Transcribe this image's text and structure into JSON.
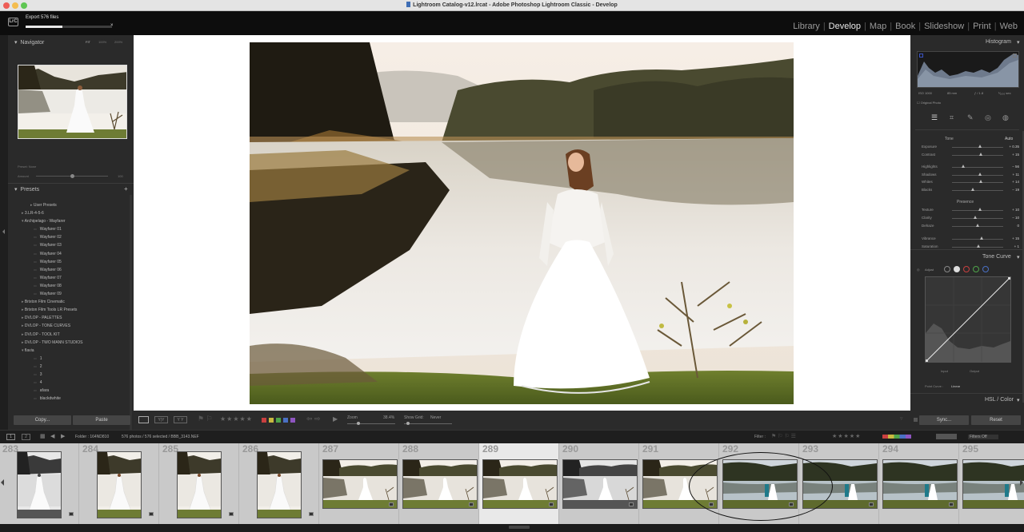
{
  "window": {
    "title": "Lightroom Catalog-v12.lrcat - Adobe Photoshop Lightroom Classic - Develop"
  },
  "identity": {
    "logo": "LrC",
    "export_label": "Export 576 files",
    "export_progress": 0.43,
    "cancel_glyph": "×"
  },
  "modules": [
    {
      "label": "Library"
    },
    {
      "label": "Develop"
    },
    {
      "label": "Map"
    },
    {
      "label": "Book"
    },
    {
      "label": "Slideshow"
    },
    {
      "label": "Print"
    },
    {
      "label": "Web"
    }
  ],
  "navigator": {
    "title": "Navigator",
    "zoom_fit": "FIT",
    "zoom_100": "100%",
    "zoom_200": "200%"
  },
  "preset_amount": {
    "label": "Preset: None",
    "amount_label": "Amount",
    "amount_value": "100"
  },
  "presets": {
    "title": "Presets",
    "add_glyph": "+",
    "items": [
      {
        "label": "User Presets",
        "level": 1
      },
      {
        "label": "3.LR-4-5-6",
        "level": 0
      },
      {
        "label": "Archipelago - Wayfarer",
        "level": 0
      },
      {
        "label": "Wayfarer 01",
        "level": 2
      },
      {
        "label": "Wayfarer 02",
        "level": 2
      },
      {
        "label": "Wayfarer 03",
        "level": 2
      },
      {
        "label": "Wayfarer 04",
        "level": 2
      },
      {
        "label": "Wayfarer 05",
        "level": 2
      },
      {
        "label": "Wayfarer 06",
        "level": 2
      },
      {
        "label": "Wayfarer 07",
        "level": 2
      },
      {
        "label": "Wayfarer 08",
        "level": 2
      },
      {
        "label": "Wayfarer 09",
        "level": 2
      },
      {
        "label": "Brixton Film Cinematic",
        "level": 0
      },
      {
        "label": "Brixton Film Tools LR Presets",
        "level": 0
      },
      {
        "label": "DVLOP - PALETTES",
        "level": 0
      },
      {
        "label": "DVLOP - TONE CURVES",
        "level": 0
      },
      {
        "label": "DVLOP - TOOL KIT",
        "level": 0
      },
      {
        "label": "DVLOP - TWO MANN STUDIOS",
        "level": 0
      },
      {
        "label": "flavia",
        "level": 0
      },
      {
        "label": "1",
        "level": 2
      },
      {
        "label": "2",
        "level": 2
      },
      {
        "label": "3",
        "level": 2
      },
      {
        "label": "4",
        "level": 2
      },
      {
        "label": "afara",
        "level": 2
      },
      {
        "label": "blackdwhite",
        "level": 2
      }
    ]
  },
  "left_buttons": {
    "copy": "Copy...",
    "paste": "Paste"
  },
  "toolbar": {
    "zoom_label": "Zoom",
    "zoom_value": "38.4%",
    "show_grid_label": "Show Grid:",
    "show_grid_value": "Never"
  },
  "histogram": {
    "title": "Histogram",
    "iso": "ISO 1000",
    "focal": "85 mm",
    "aperture": "ƒ / 1.8",
    "shutter": "¹⁄₁₆₀₀ sec",
    "original_photo": "Original Photo"
  },
  "basic": {
    "tone_label": "Tone",
    "auto_label": "Auto",
    "sliders": [
      {
        "label": "Exposure",
        "value": "+ 0.35",
        "pos": 0.55
      },
      {
        "label": "Contrast",
        "value": "+ 15",
        "pos": 0.57
      },
      {
        "label": "Highlights",
        "value": "− 56",
        "pos": 0.22
      },
      {
        "label": "Shadows",
        "value": "+ 11",
        "pos": 0.55
      },
      {
        "label": "Whites",
        "value": "+ 14",
        "pos": 0.57
      },
      {
        "label": "Blacks",
        "value": "− 19",
        "pos": 0.4
      }
    ],
    "presence_label": "Presence",
    "presence_sliders": [
      {
        "label": "Texture",
        "value": "+ 10",
        "pos": 0.55
      },
      {
        "label": "Clarity",
        "value": "− 10",
        "pos": 0.45
      },
      {
        "label": "Dehaze",
        "value": "0",
        "pos": 0.5
      },
      {
        "label": "Vibrance",
        "value": "+ 15",
        "pos": 0.58
      },
      {
        "label": "Saturation",
        "value": "+ 1",
        "pos": 0.51
      }
    ]
  },
  "tone_curve": {
    "title": "Tone Curve",
    "adjust_label": "Adjust",
    "input_label": "Input",
    "output_label": "Output",
    "point_curve_label": "Point Curve :",
    "point_curve_value": "Linear"
  },
  "hsl": {
    "title": "HSL / Color"
  },
  "right_buttons": {
    "sync": "Sync...",
    "reset": "Reset"
  },
  "filmbar": {
    "folder": "Folder : 164ND810",
    "count": "576 photos / 576 selected / BBB_3143.NEF",
    "filter_label": "Filter :",
    "filters_off": "Filters Off"
  },
  "filmstrip": {
    "frames": [
      {
        "num": "283",
        "kind": "portrait-bw"
      },
      {
        "num": "284",
        "kind": "portrait"
      },
      {
        "num": "285",
        "kind": "portrait"
      },
      {
        "num": "286",
        "kind": "portrait"
      },
      {
        "num": "287",
        "kind": "landscape"
      },
      {
        "num": "288",
        "kind": "landscape"
      },
      {
        "num": "289",
        "kind": "landscape",
        "selected": true
      },
      {
        "num": "290",
        "kind": "landscape-bw"
      },
      {
        "num": "291",
        "kind": "landscape"
      },
      {
        "num": "292",
        "kind": "couple"
      },
      {
        "num": "293",
        "kind": "couple"
      },
      {
        "num": "294",
        "kind": "couple"
      },
      {
        "num": "295",
        "kind": "couple"
      }
    ]
  },
  "colors": {
    "accent": "#e8e8e8",
    "panel": "#2a2a2a",
    "filmstrip": "#c9c9c9"
  }
}
